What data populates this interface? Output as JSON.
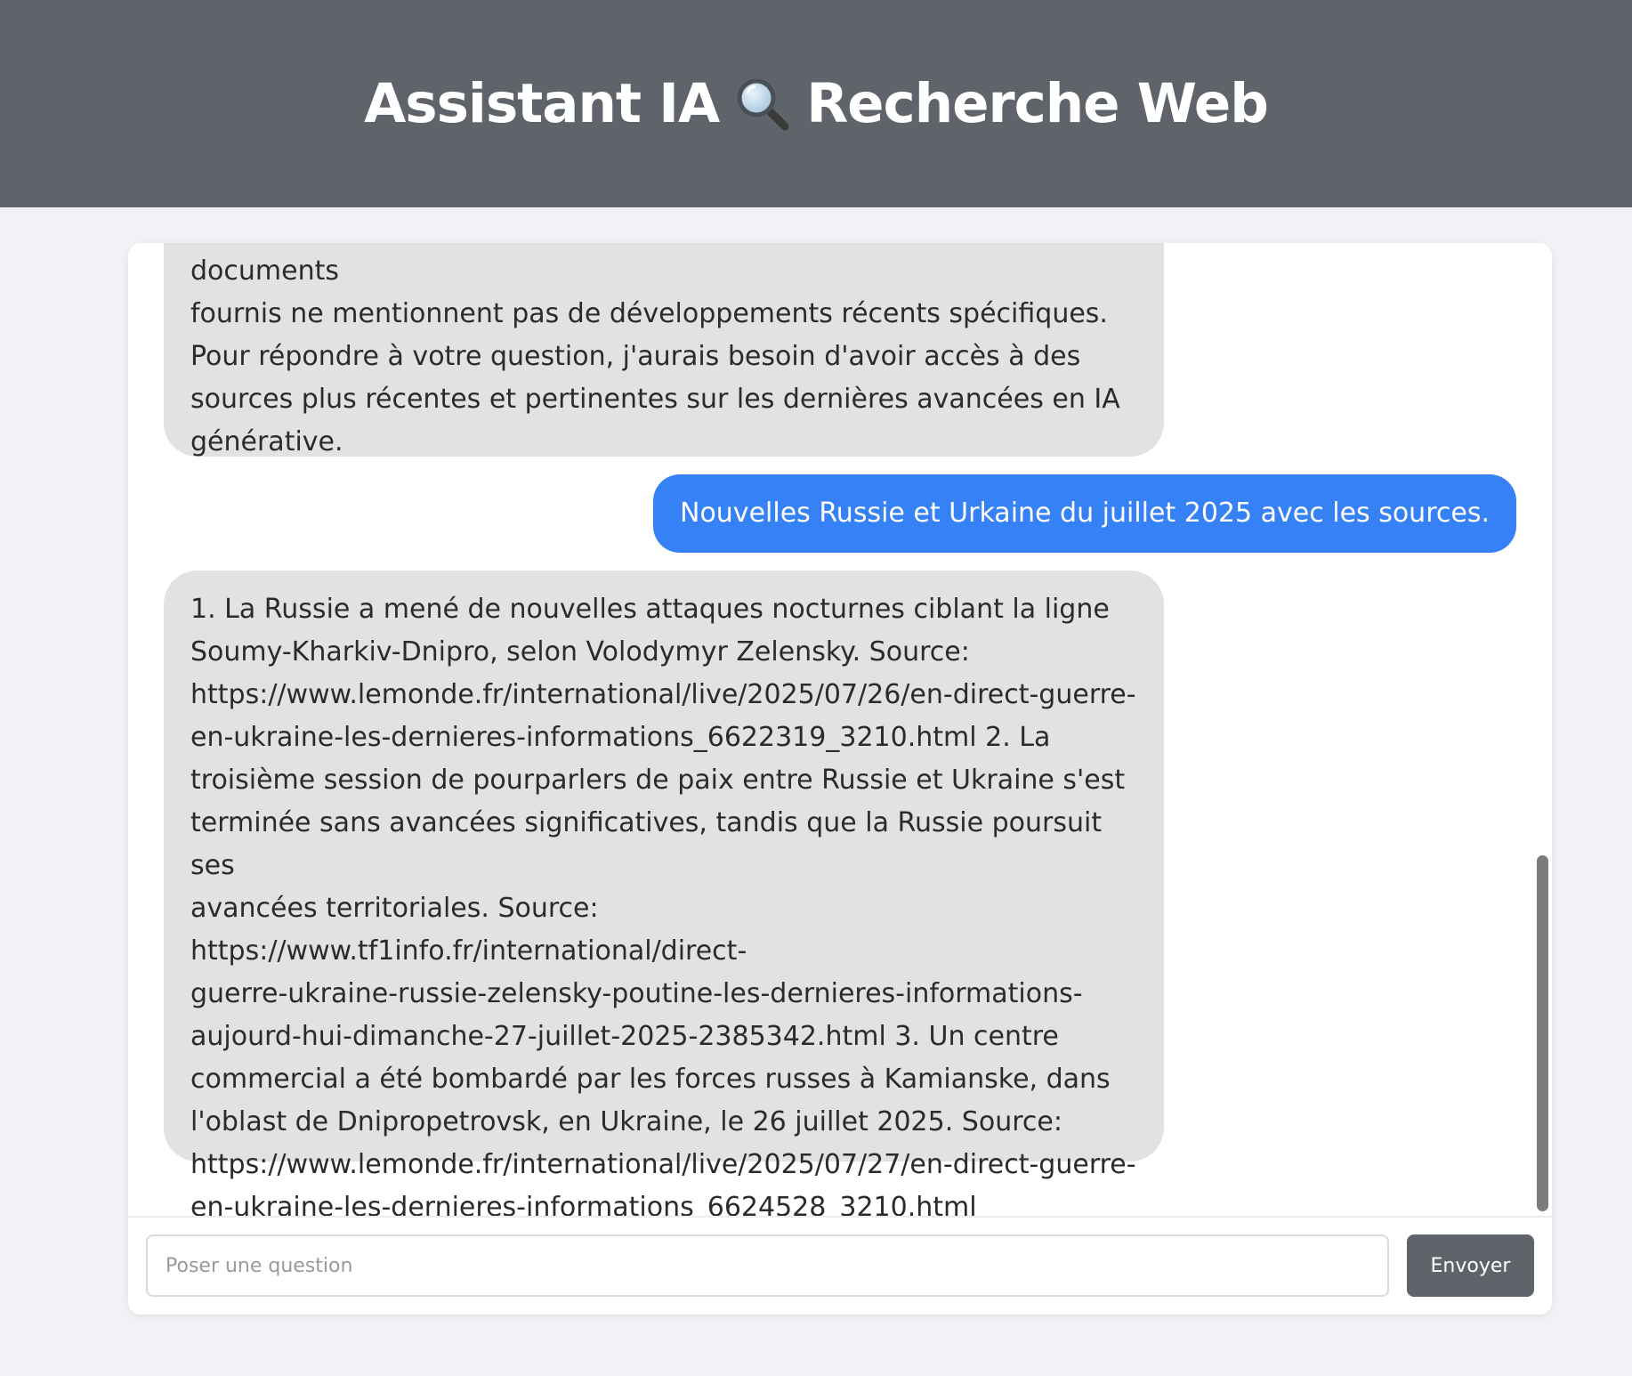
{
  "header": {
    "title_part1": "Assistant IA",
    "title_part2": "Recherche Web",
    "title_icon": "magnifying-glass-icon"
  },
  "messages": [
    {
      "role": "assistant",
      "text": "annonces cette semaine avec des sources fiables. Les trois documents\nfournis ne mentionnent pas de développements récents spécifiques.\nPour répondre à votre question, j'aurais besoin d'avoir accès à des\nsources plus récentes et pertinentes sur les dernières avancées en IA\ngénérative."
    },
    {
      "role": "user",
      "text": "Nouvelles Russie et Urkaine du juillet 2025 avec les sources."
    },
    {
      "role": "assistant",
      "text": "1. La Russie a mené de nouvelles attaques nocturnes ciblant la ligne\nSoumy-Kharkiv-Dnipro, selon Volodymyr Zelensky. Source:\nhttps://www.lemonde.fr/international/live/2025/07/26/en-direct-guerre-\nen-ukraine-les-dernieres-informations_6622319_3210.html 2. La\ntroisième session de pourparlers de paix entre Russie et Ukraine s'est\nterminée sans avancées significatives, tandis que la Russie poursuit ses\navancées territoriales. Source: https://www.tf1info.fr/international/direct-\nguerre-ukraine-russie-zelensky-poutine-les-dernieres-informations-\naujourd-hui-dimanche-27-juillet-2025-2385342.html 3. Un centre\ncommercial a été bombardé par les forces russes à Kamianske, dans\nl'oblast de Dnipropetrovsk, en Ukraine, le 26 juillet 2025. Source:\nhttps://www.lemonde.fr/international/live/2025/07/27/en-direct-guerre-\nen-ukraine-les-dernieres-informations_6624528_3210.html"
    }
  ],
  "composer": {
    "placeholder": "Poser une question",
    "value": "",
    "send_label": "Envoyer"
  },
  "colors": {
    "header_bg": "#5f646b",
    "user_bubble": "#3581f5",
    "assistant_bubble": "#e2e2e3",
    "page_bg": "#f0f2f5"
  }
}
